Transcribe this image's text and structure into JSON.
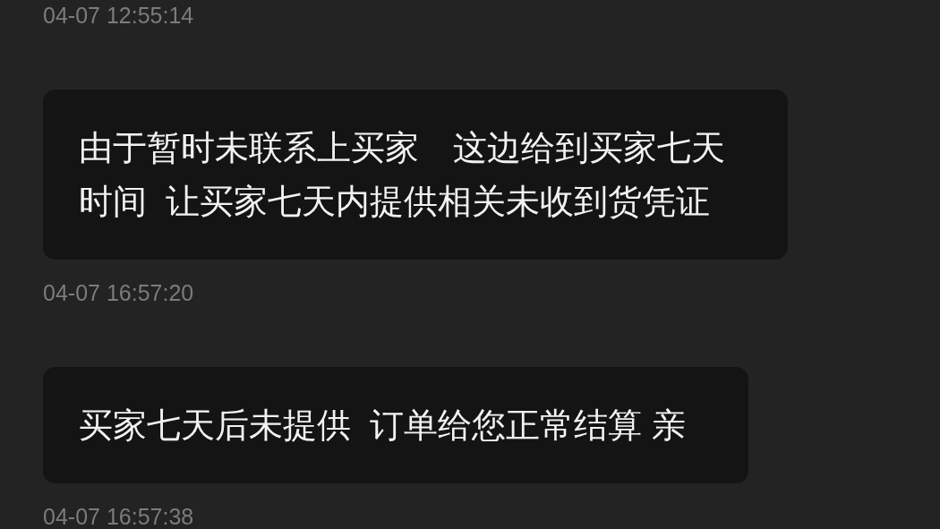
{
  "messages": [
    {
      "time": "04-07 12:55:14",
      "lines": [
        "由于暂时未联系上买家　这边给到买家七天",
        "时间  让买家七天内提供相关未收到货凭证"
      ]
    },
    {
      "time": "04-07 16:57:20",
      "lines": [
        "买家七天后未提供  订单给您正常结算 亲"
      ]
    },
    {
      "time": "04-07 16:57:38"
    }
  ]
}
